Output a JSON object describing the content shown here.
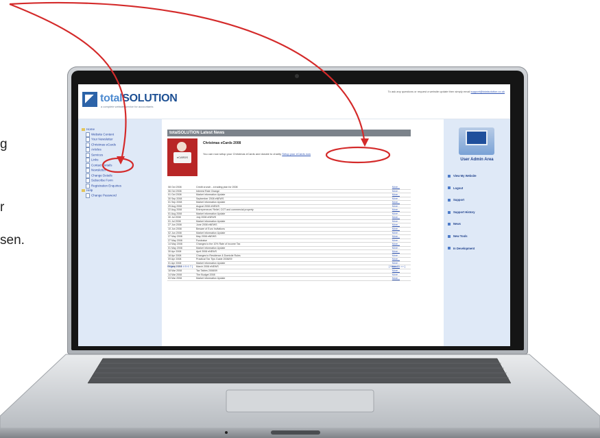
{
  "left_text": [
    "g",
    "r",
    "sen."
  ],
  "site": {
    "logo_main": "total",
    "logo_rest": "SOLUTION",
    "logo_tagline": "a complete website service for accountants",
    "contact_text": "To ask any questions or request a website update then simply email",
    "contact_email": "support@totalsolution.co.uk"
  },
  "sidebar": {
    "tree": [
      {
        "label": "Home",
        "kind": "folder"
      },
      {
        "label": "Website Content",
        "kind": "page"
      },
      {
        "label": "Your Newsletter",
        "kind": "page"
      },
      {
        "label": "Christmas eCards",
        "kind": "page"
      },
      {
        "label": "Articles",
        "kind": "page"
      },
      {
        "label": "Services",
        "kind": "page"
      },
      {
        "label": "Links",
        "kind": "page"
      },
      {
        "label": "Contact Details",
        "kind": "page"
      },
      {
        "label": "Newsletter",
        "kind": "page"
      },
      {
        "label": "Change Details",
        "kind": "page"
      },
      {
        "label": "Subscribe Form",
        "kind": "page"
      },
      {
        "label": "Registration Enquiries",
        "kind": "page"
      },
      {
        "label": "Help",
        "kind": "folder"
      },
      {
        "label": "Change Password",
        "kind": "page"
      }
    ]
  },
  "news": {
    "header": "totalSOLUTION Latest News",
    "ecard_title": "Christmas eCards 2008",
    "ecard_image_label": "eCARDS",
    "ecard_desc": "You can now setup your Christmas eCards and donate to charity",
    "ecard_link": "Setup your eCards now",
    "more_label": "More...",
    "rows": [
      {
        "date": "08 Oct 2008",
        "title": "Credit crunch - a trading plan for 2008"
      },
      {
        "date": "06 Oct 2008",
        "title": "Interest Rate Change"
      },
      {
        "date": "01 Oct 2008",
        "title": "Market information Update"
      },
      {
        "date": "30 Sep 2008",
        "title": "September 2008 eNEWS"
      },
      {
        "date": "01 Sep 2008",
        "title": "Market information Update"
      },
      {
        "date": "29 Aug 2008",
        "title": "August 2008 eNEWS"
      },
      {
        "date": "22 Aug 2008",
        "title": "Entrepreneurs' Relief, CGT and commercial property"
      },
      {
        "date": "01 Aug 2008",
        "title": "Market information Update"
      },
      {
        "date": "30 Jul 2008",
        "title": "July 2008 eNEWS"
      },
      {
        "date": "01 Jul 2008",
        "title": "Market information Update"
      },
      {
        "date": "27 Jun 2008",
        "title": "June 2008 eNEWS"
      },
      {
        "date": "10 Jun 2008",
        "title": "Beware of Euro Invitations"
      },
      {
        "date": "02 Jun 2008",
        "title": "Market information Update"
      },
      {
        "date": "27 May 2008",
        "title": "May 2008 eNEWS"
      },
      {
        "date": "27 May 2008",
        "title": "Fundraise"
      },
      {
        "date": "14 May 2008",
        "title": "Changes to the 10% Rate of Income Tax"
      },
      {
        "date": "01 May 2008",
        "title": "Market information Update"
      },
      {
        "date": "30 Apr 2008",
        "title": "April 2008 eNEWS"
      },
      {
        "date": "18 Apr 2008",
        "title": "Changes to Residence & Domicile Rules"
      },
      {
        "date": "09 Apr 2008",
        "title": "Practical Tax Tips Guide 2008/09"
      },
      {
        "date": "01 Apr 2008",
        "title": "Market information Update"
      },
      {
        "date": "27 Mar 2008",
        "title": "March 2008 eNEWS"
      },
      {
        "date": "18 Mar 2008",
        "title": "Tax Tables 2008/09"
      },
      {
        "date": "14 Mar 2008",
        "title": "The Budget 2008"
      },
      {
        "date": "03 Mar 2008",
        "title": "Market information Update"
      }
    ],
    "pager_left": "Page [ 1 2 3 4 5 6 7 ]",
    "pager_right": "[ Next 25 >> ]"
  },
  "admin": {
    "title": "User Admin Area",
    "menu": [
      "View My Website",
      "Logout",
      "Support",
      "Support History",
      "News",
      "New Tools",
      "In Development"
    ]
  },
  "colors": {
    "annotation": "#d42a2a",
    "brand": "#1c4f93",
    "sidebar_bg": "#dfe9f7"
  }
}
